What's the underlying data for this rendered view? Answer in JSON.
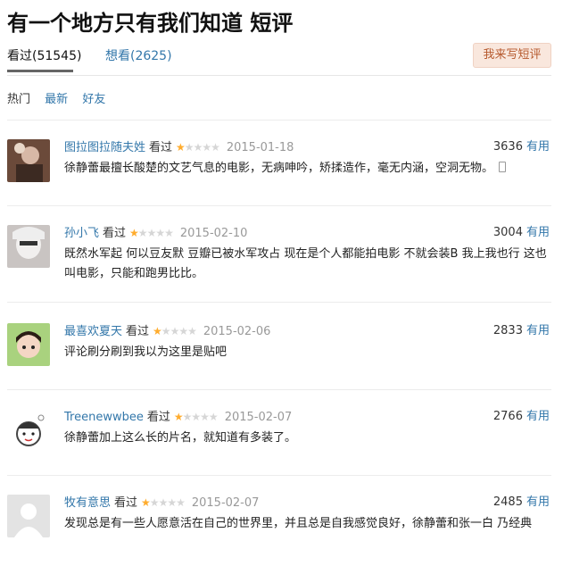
{
  "page": {
    "title": "有一个地方只有我们知道 短评"
  },
  "tabs": [
    {
      "label": "看过(51545)"
    },
    {
      "label": "想看(2625)"
    }
  ],
  "write_button": {
    "label": "我来写短评"
  },
  "filters": [
    {
      "label": "热门"
    },
    {
      "label": "最新"
    },
    {
      "label": "好友"
    }
  ],
  "reviews": [
    {
      "user": "图拉图拉随夫姓",
      "status": "看过",
      "rating": 1,
      "max_rating": 5,
      "date": "2015-01-18",
      "votes": "3636",
      "useful_label": "有用",
      "content": "徐静蕾最擅长酸楚的文艺气息的电影，无病呻吟，矫揉造作，毫无内涵，空洞无物。"
    },
    {
      "user": "孙小飞",
      "status": "看过",
      "rating": 1,
      "max_rating": 5,
      "date": "2015-02-10",
      "votes": "3004",
      "useful_label": "有用",
      "content": "既然水军起 何以豆友默 豆瓣已被水军攻占 现在是个人都能拍电影 不就会装B 我上我也行 这也叫电影，只能和跑男比比。"
    },
    {
      "user": "最喜欢夏天",
      "status": "看过",
      "rating": 1,
      "max_rating": 5,
      "date": "2015-02-06",
      "votes": "2833",
      "useful_label": "有用",
      "content": "评论刷分刷到我以为这里是贴吧"
    },
    {
      "user": "Treenewwbee",
      "status": "看过",
      "rating": 1,
      "max_rating": 5,
      "date": "2015-02-07",
      "votes": "2766",
      "useful_label": "有用",
      "content": "徐静蕾加上这么长的片名，就知道有多装了。"
    },
    {
      "user": "牧有意思",
      "status": "看过",
      "rating": 1,
      "max_rating": 5,
      "date": "2015-02-07",
      "votes": "2485",
      "useful_label": "有用",
      "content": "发现总是有一些人愿意活在自己的世界里，并且总是自我感觉良好，徐静蕾和张一白 乃经典"
    }
  ],
  "colors": {
    "link": "#3377aa",
    "star": "#ffac2d",
    "button_bg": "#f9e7dd",
    "button_text": "#b65a2e"
  }
}
